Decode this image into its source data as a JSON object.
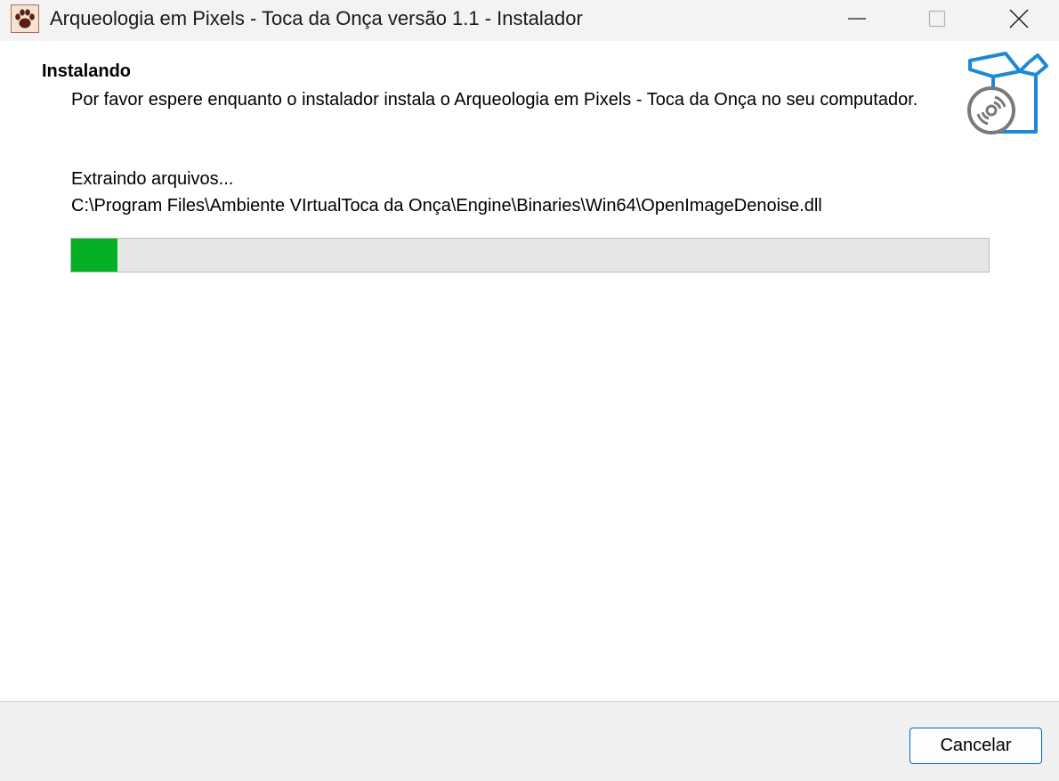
{
  "window": {
    "title": "Arqueologia em Pixels - Toca da Onça versão 1.1 - Instalador",
    "app_icon": "paw-icon",
    "controls": [
      "minimize-icon",
      "maximize-icon",
      "close-icon"
    ]
  },
  "header": {
    "title": "Instalando",
    "description": "Por favor espere enquanto o instalador instala o Arqueologia em Pixels - Toca da Onça no seu computador.",
    "icon": "install-box-disc-icon"
  },
  "main": {
    "status": "Extraindo arquivos...",
    "current_file": "C:\\Program Files\\Ambiente VIrtualToca da Onça\\Engine\\Binaries\\Win64\\OpenImageDenoise.dll",
    "progress": 0.05
  },
  "footer": {
    "cancel_label": "Cancelar"
  },
  "colors": {
    "progress_fill": "#06b025",
    "progress_track": "#e6e6e6",
    "accent_border": "#0067c0",
    "icon_blue": "#1e88d6"
  }
}
